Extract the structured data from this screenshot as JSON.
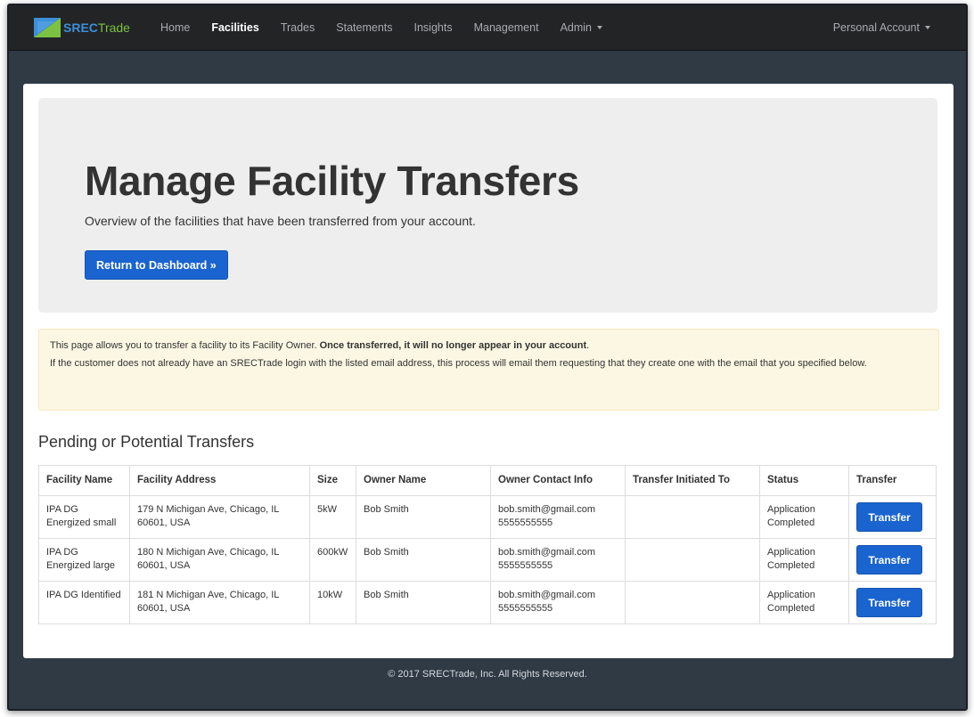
{
  "brand": {
    "name_main": "SREC",
    "name_accent": "Trade"
  },
  "nav": {
    "items": [
      {
        "label": "Home",
        "active": false
      },
      {
        "label": "Facilities",
        "active": true
      },
      {
        "label": "Trades",
        "active": false
      },
      {
        "label": "Statements",
        "active": false
      },
      {
        "label": "Insights",
        "active": false
      },
      {
        "label": "Management",
        "active": false
      },
      {
        "label": "Admin",
        "active": false
      }
    ],
    "account_label": "Personal Account"
  },
  "jumbotron": {
    "title": "Manage Facility Transfers",
    "subtitle": "Overview of the facilities that have been transferred from your account.",
    "button_label": "Return to Dashboard »"
  },
  "alert": {
    "line1_text": "This page allows you to transfer a facility to its Facility Owner. ",
    "line1_bold": "Once transferred, it will no longer appear in your account",
    "line1_end": ".",
    "line2": "If the customer does not already have an SRECTrade login with the listed email address, this process will email them requesting that they create one with the email that you specified below."
  },
  "section_title": "Pending or Potential Transfers",
  "table": {
    "headers": [
      "Facility Name",
      "Facility Address",
      "Size",
      "Owner Name",
      "Owner Contact Info",
      "Transfer Initiated To",
      "Status",
      "Transfer"
    ],
    "rows": [
      {
        "name": "IPA DG Energized small",
        "address": "179 N Michigan Ave, Chicago, IL 60601, USA",
        "size": "5kW",
        "owner": "Bob Smith",
        "email": "bob.smith@gmail.com",
        "phone": "5555555555",
        "initiated": "",
        "status": "Application Completed",
        "button": "Transfer"
      },
      {
        "name": "IPA DG Energized large",
        "address": "180 N Michigan Ave, Chicago, IL 60601, USA",
        "size": "600kW",
        "owner": "Bob Smith",
        "email": "bob.smith@gmail.com",
        "phone": "5555555555",
        "initiated": "",
        "status": "Application Completed",
        "button": "Transfer"
      },
      {
        "name": "IPA DG Identified",
        "address": "181 N Michigan Ave, Chicago, IL 60601, USA",
        "size": "10kW",
        "owner": "Bob Smith",
        "email": "bob.smith@gmail.com",
        "phone": "5555555555",
        "initiated": "",
        "status": "Application Completed",
        "button": "Transfer"
      }
    ]
  },
  "footer": "© 2017 SRECTrade, Inc. All Rights Reserved.",
  "colors": {
    "primary_button": "#1a64cf",
    "navbar": "#222426",
    "page_background": "#2f3a45",
    "alert_background": "#fcf7e3",
    "brand_blue": "#3d8fd8",
    "brand_green": "#7cc242"
  },
  "icons": {
    "brand_logo": "srectrade-logo-icon",
    "dropdown": "caret-down-icon"
  }
}
